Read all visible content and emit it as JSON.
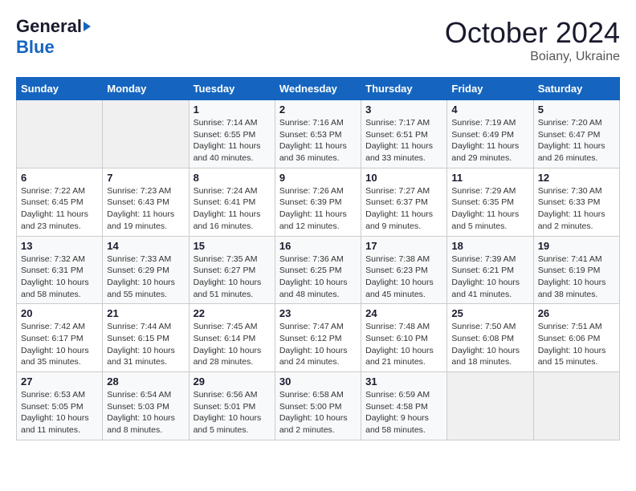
{
  "header": {
    "logo": {
      "line1": "General",
      "line2": "Blue"
    },
    "title": "October 2024",
    "subtitle": "Boiany, Ukraine"
  },
  "weekdays": [
    "Sunday",
    "Monday",
    "Tuesday",
    "Wednesday",
    "Thursday",
    "Friday",
    "Saturday"
  ],
  "weeks": [
    [
      {
        "day": "",
        "info": ""
      },
      {
        "day": "",
        "info": ""
      },
      {
        "day": "1",
        "info": "Sunrise: 7:14 AM\nSunset: 6:55 PM\nDaylight: 11 hours and 40 minutes."
      },
      {
        "day": "2",
        "info": "Sunrise: 7:16 AM\nSunset: 6:53 PM\nDaylight: 11 hours and 36 minutes."
      },
      {
        "day": "3",
        "info": "Sunrise: 7:17 AM\nSunset: 6:51 PM\nDaylight: 11 hours and 33 minutes."
      },
      {
        "day": "4",
        "info": "Sunrise: 7:19 AM\nSunset: 6:49 PM\nDaylight: 11 hours and 29 minutes."
      },
      {
        "day": "5",
        "info": "Sunrise: 7:20 AM\nSunset: 6:47 PM\nDaylight: 11 hours and 26 minutes."
      }
    ],
    [
      {
        "day": "6",
        "info": "Sunrise: 7:22 AM\nSunset: 6:45 PM\nDaylight: 11 hours and 23 minutes."
      },
      {
        "day": "7",
        "info": "Sunrise: 7:23 AM\nSunset: 6:43 PM\nDaylight: 11 hours and 19 minutes."
      },
      {
        "day": "8",
        "info": "Sunrise: 7:24 AM\nSunset: 6:41 PM\nDaylight: 11 hours and 16 minutes."
      },
      {
        "day": "9",
        "info": "Sunrise: 7:26 AM\nSunset: 6:39 PM\nDaylight: 11 hours and 12 minutes."
      },
      {
        "day": "10",
        "info": "Sunrise: 7:27 AM\nSunset: 6:37 PM\nDaylight: 11 hours and 9 minutes."
      },
      {
        "day": "11",
        "info": "Sunrise: 7:29 AM\nSunset: 6:35 PM\nDaylight: 11 hours and 5 minutes."
      },
      {
        "day": "12",
        "info": "Sunrise: 7:30 AM\nSunset: 6:33 PM\nDaylight: 11 hours and 2 minutes."
      }
    ],
    [
      {
        "day": "13",
        "info": "Sunrise: 7:32 AM\nSunset: 6:31 PM\nDaylight: 10 hours and 58 minutes."
      },
      {
        "day": "14",
        "info": "Sunrise: 7:33 AM\nSunset: 6:29 PM\nDaylight: 10 hours and 55 minutes."
      },
      {
        "day": "15",
        "info": "Sunrise: 7:35 AM\nSunset: 6:27 PM\nDaylight: 10 hours and 51 minutes."
      },
      {
        "day": "16",
        "info": "Sunrise: 7:36 AM\nSunset: 6:25 PM\nDaylight: 10 hours and 48 minutes."
      },
      {
        "day": "17",
        "info": "Sunrise: 7:38 AM\nSunset: 6:23 PM\nDaylight: 10 hours and 45 minutes."
      },
      {
        "day": "18",
        "info": "Sunrise: 7:39 AM\nSunset: 6:21 PM\nDaylight: 10 hours and 41 minutes."
      },
      {
        "day": "19",
        "info": "Sunrise: 7:41 AM\nSunset: 6:19 PM\nDaylight: 10 hours and 38 minutes."
      }
    ],
    [
      {
        "day": "20",
        "info": "Sunrise: 7:42 AM\nSunset: 6:17 PM\nDaylight: 10 hours and 35 minutes."
      },
      {
        "day": "21",
        "info": "Sunrise: 7:44 AM\nSunset: 6:15 PM\nDaylight: 10 hours and 31 minutes."
      },
      {
        "day": "22",
        "info": "Sunrise: 7:45 AM\nSunset: 6:14 PM\nDaylight: 10 hours and 28 minutes."
      },
      {
        "day": "23",
        "info": "Sunrise: 7:47 AM\nSunset: 6:12 PM\nDaylight: 10 hours and 24 minutes."
      },
      {
        "day": "24",
        "info": "Sunrise: 7:48 AM\nSunset: 6:10 PM\nDaylight: 10 hours and 21 minutes."
      },
      {
        "day": "25",
        "info": "Sunrise: 7:50 AM\nSunset: 6:08 PM\nDaylight: 10 hours and 18 minutes."
      },
      {
        "day": "26",
        "info": "Sunrise: 7:51 AM\nSunset: 6:06 PM\nDaylight: 10 hours and 15 minutes."
      }
    ],
    [
      {
        "day": "27",
        "info": "Sunrise: 6:53 AM\nSunset: 5:05 PM\nDaylight: 10 hours and 11 minutes."
      },
      {
        "day": "28",
        "info": "Sunrise: 6:54 AM\nSunset: 5:03 PM\nDaylight: 10 hours and 8 minutes."
      },
      {
        "day": "29",
        "info": "Sunrise: 6:56 AM\nSunset: 5:01 PM\nDaylight: 10 hours and 5 minutes."
      },
      {
        "day": "30",
        "info": "Sunrise: 6:58 AM\nSunset: 5:00 PM\nDaylight: 10 hours and 2 minutes."
      },
      {
        "day": "31",
        "info": "Sunrise: 6:59 AM\nSunset: 4:58 PM\nDaylight: 9 hours and 58 minutes."
      },
      {
        "day": "",
        "info": ""
      },
      {
        "day": "",
        "info": ""
      }
    ]
  ]
}
